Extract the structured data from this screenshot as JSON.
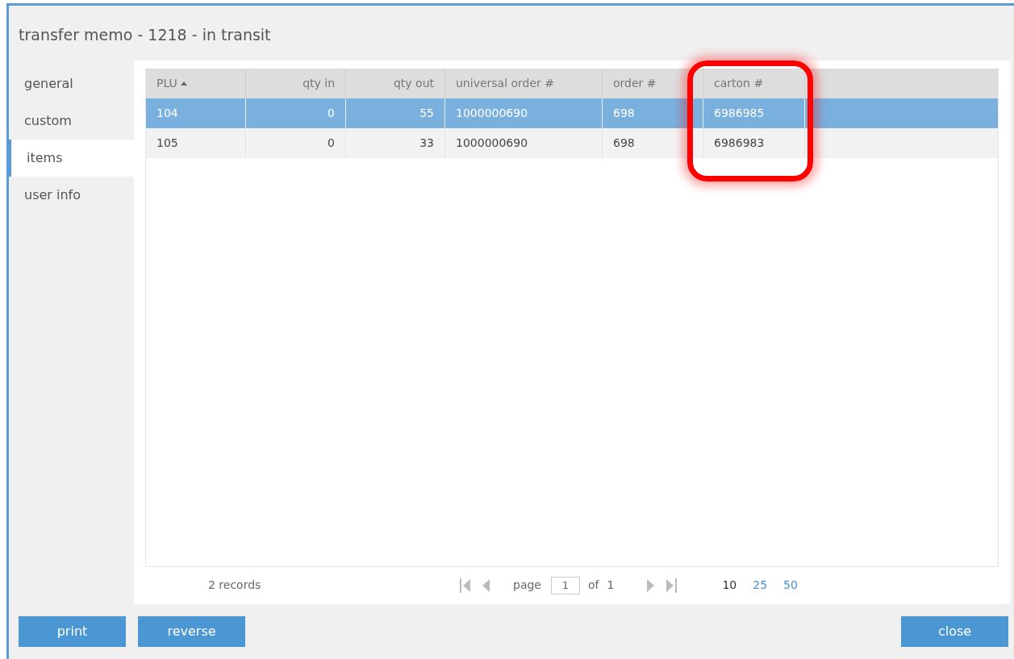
{
  "window": {
    "title": "transfer memo - 1218 - in transit"
  },
  "sidebar": {
    "items": [
      {
        "label": "general",
        "selected": false
      },
      {
        "label": "custom",
        "selected": false
      },
      {
        "label": "items",
        "selected": true
      },
      {
        "label": "user info",
        "selected": false
      }
    ]
  },
  "table": {
    "columns": [
      {
        "label": "PLU",
        "kind": "text",
        "sorted": true
      },
      {
        "label": "qty in",
        "kind": "number",
        "sorted": false
      },
      {
        "label": "qty out",
        "kind": "number",
        "sorted": false
      },
      {
        "label": "universal order #",
        "kind": "text",
        "sorted": false
      },
      {
        "label": "order #",
        "kind": "text",
        "sorted": false
      },
      {
        "label": "carton #",
        "kind": "text",
        "sorted": false
      }
    ],
    "rows": [
      {
        "selected": true,
        "cells": [
          "104",
          "0",
          "55",
          "1000000690",
          "698",
          "6986985"
        ]
      },
      {
        "selected": false,
        "cells": [
          "105",
          "0",
          "33",
          "1000000690",
          "698",
          "6986983"
        ]
      }
    ]
  },
  "pager": {
    "records": "2 records",
    "page_label": "page",
    "page": "1",
    "of_label": "of",
    "total": "1",
    "sizes": [
      {
        "label": "10",
        "selected": true
      },
      {
        "label": "25",
        "selected": false
      },
      {
        "label": "50",
        "selected": false
      }
    ]
  },
  "buttons": {
    "left": [
      "print",
      "reverse"
    ],
    "right": [
      "close"
    ]
  }
}
